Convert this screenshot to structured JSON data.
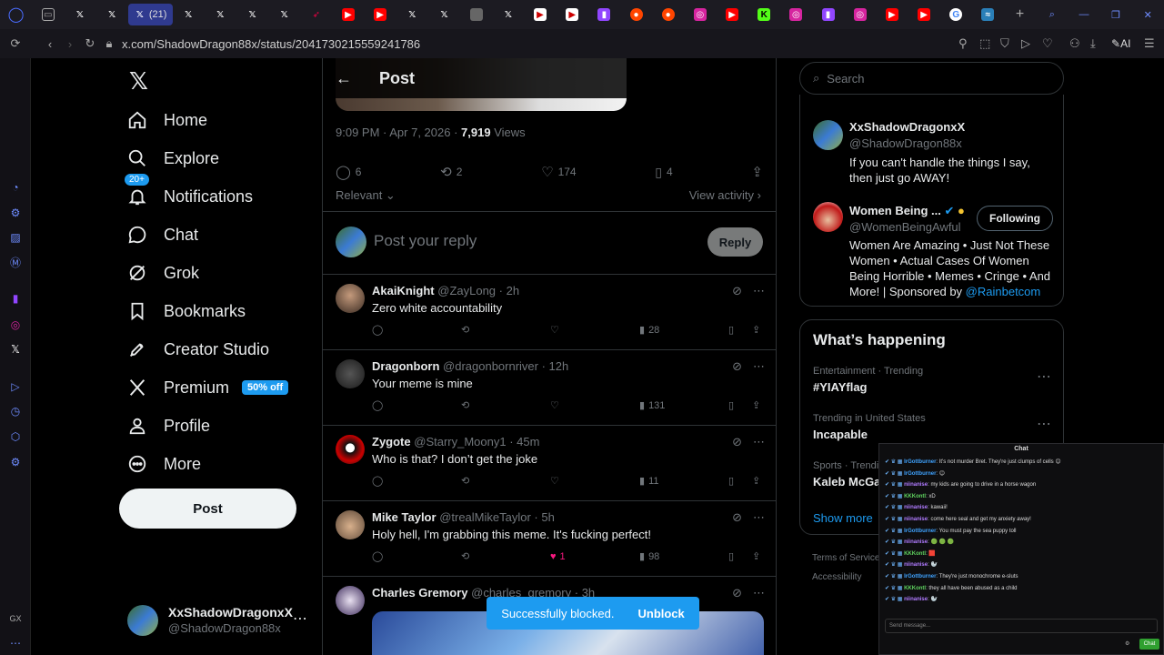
{
  "browser": {
    "active_tab_count": "(21)",
    "url": "x.com/ShadowDragon88x/status/2041730215559241786",
    "ai_label": "AI"
  },
  "nav": {
    "home": "Home",
    "explore": "Explore",
    "notifications": "Notifications",
    "notif_badge": "20+",
    "chat": "Chat",
    "grok": "Grok",
    "bookmarks": "Bookmarks",
    "creator_studio": "Creator Studio",
    "premium": "Premium",
    "premium_badge": "50% off",
    "profile": "Profile",
    "more": "More",
    "post_button": "Post"
  },
  "account": {
    "name": "XxShadowDragonxX",
    "handle": "@ShadowDragon88x"
  },
  "post": {
    "header_title": "Post",
    "time": "9:09 PM · Apr 7, 2026 · ",
    "views_count": "7,919",
    "views_label": " Views",
    "replies": "6",
    "reposts": "2",
    "likes": "174",
    "bookmarks": "4",
    "sort_label": "Relevant",
    "view_activity": "View activity",
    "reply_placeholder": "Post your reply",
    "reply_button": "Reply"
  },
  "replies": [
    {
      "name": "AkaiKnight",
      "handle": "@ZayLong · 2h",
      "text": "Zero white accountability",
      "views": "28",
      "likes": ""
    },
    {
      "name": "Dragonborn",
      "handle": "@dragonbornriver · 12h",
      "text": "Your meme is mine",
      "views": "131",
      "likes": ""
    },
    {
      "name": "Zygote",
      "handle": "@Starry_Moony1 · 45m",
      "text": "Who is that? I don’t get the joke",
      "views": "11",
      "likes": ""
    },
    {
      "name": "Mike Taylor",
      "handle": "@trealMikeTaylor · 5h",
      "text": "Holy hell, I'm grabbing this meme. It's fucking perfect!",
      "views": "98",
      "likes": "1"
    },
    {
      "name": "Charles Gremory",
      "handle": "@charles_gremory · 3h",
      "text": "",
      "views": "",
      "likes": ""
    }
  ],
  "right": {
    "search_placeholder": "Search",
    "profile1": {
      "name": "XxShadowDragonxX",
      "handle": "@ShadowDragon88x",
      "bio": "If you can't handle the things I say, then just go AWAY!"
    },
    "profile2": {
      "name": "Women Being ...",
      "handle": "@WomenBeingAwful",
      "follow": "Following",
      "bio": "Women Are Amazing • Just Not These Women • Actual Cases Of Women Being Horrible • Memes • Cringe • And More! | Sponsored by ",
      "bio_link": "@Rainbetcom"
    },
    "happening_title": "What’s happening",
    "trends": [
      {
        "context": "Entertainment · Trending",
        "topic": "#YIAYflag"
      },
      {
        "context": "Trending in United States",
        "topic": "Incapable"
      },
      {
        "context": "Sports · Trendi",
        "topic": "Kaleb McGa"
      }
    ],
    "show_more": "Show more",
    "footer1": "Terms of Service",
    "footer2": "Accessibility"
  },
  "toast": {
    "message": "Successfully blocked.",
    "action": "Unblock"
  },
  "chat": {
    "title": "Chat",
    "lines": [
      {
        "user": "IrGottburner",
        "msg": "It's not murder Bret. They're just clumps of cells 😊",
        "color": "#3fa3ff"
      },
      {
        "user": "IrGottburner",
        "msg": "😊",
        "color": "#3fa3ff"
      },
      {
        "user": "niinanise",
        "msg": "my kids are going to drive in a horse wagon",
        "color": "#b07bff"
      },
      {
        "user": "KKKontl",
        "msg": "xD",
        "color": "#5fd35f"
      },
      {
        "user": "niinanise",
        "msg": "kawaii!",
        "color": "#b07bff"
      },
      {
        "user": "niinanise",
        "msg": "come here seal and get my anxiety away!",
        "color": "#b07bff"
      },
      {
        "user": "IrGottburner",
        "msg": "You must pay the sea puppy toll",
        "color": "#3fa3ff"
      },
      {
        "user": "niinanise",
        "msg": "🟢 🟢 🟢",
        "color": "#b07bff"
      },
      {
        "user": "KKKontl",
        "msg": "🟥",
        "color": "#5fd35f"
      },
      {
        "user": "niinanise",
        "msg": "🦭",
        "color": "#b07bff"
      },
      {
        "user": "IrGottburner",
        "msg": "They're just monochrome e-sluts",
        "color": "#3fa3ff"
      },
      {
        "user": "KKKontl",
        "msg": "they all have been abused as a child",
        "color": "#5fd35f"
      },
      {
        "user": "niinanise",
        "msg": "🦭",
        "color": "#b07bff"
      }
    ],
    "input_placeholder": "Send message...",
    "send": "Chat"
  }
}
